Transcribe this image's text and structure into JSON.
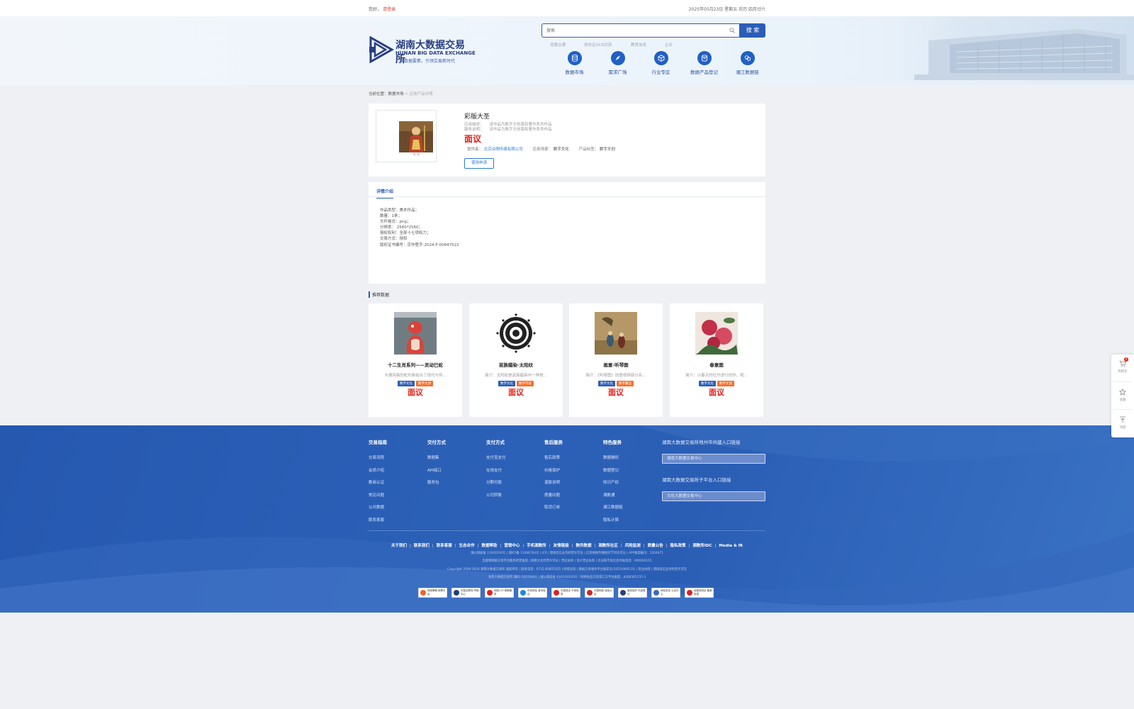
{
  "topbar": {
    "greeting": "您好，",
    "login": "请登录",
    "date": "2025年05月23日 星期五 农历 四月廿六"
  },
  "logo": {
    "cn": "湖南大数据交易所",
    "en": "HUNAN BIG DATA EXCHANGE",
    "slogan": "汇聚数据要素，引领交易新时代"
  },
  "search": {
    "placeholder": "搜索",
    "button": "搜 索",
    "hot": [
      "道路交通",
      "身份证OCR识别",
      "教育信息",
      "企业"
    ]
  },
  "nav": [
    {
      "label": "数据市场",
      "icon": "database-icon"
    },
    {
      "label": "需求广场",
      "icon": "compass-icon"
    },
    {
      "label": "行业专区",
      "icon": "cube-icon"
    },
    {
      "label": "数据产品登记",
      "icon": "register-icon"
    },
    {
      "label": "湘江数据链",
      "icon": "link-icon"
    }
  ],
  "breadcrumb": {
    "prefix": "当前位置：",
    "market": "数据市场",
    "sep": " > ",
    "current": "应用产品详情"
  },
  "product": {
    "thumb_caption": "彩 版",
    "title": "彩版大圣",
    "usage_label": "应用描述：",
    "usage_value": "该作品为数字文创版权著作系列作品",
    "service_label": "服务说明：",
    "service_value": "该作品为数字文创版权著作系列作品",
    "price": "面议",
    "provider_label": "提供者：",
    "provider_value": "北京泊侗传媒有限公司",
    "scene_label": "应用场景：",
    "scene_value": "数字文化",
    "tag_label": "产品标签：",
    "tag_value": "数字文创",
    "apply_button": "使用申请"
  },
  "detail": {
    "tab": "详情介绍",
    "lines": [
      "作品类型：美术作品；",
      "数量：1条；",
      "文件格式：png；",
      "分辨率：  2560*2560；",
      "授权权利：全部十七项权力；",
      "交易方式：授权",
      "版权证书编号：京作登字-2024-F-00847522"
    ]
  },
  "recommend": {
    "title": "推荐数据",
    "cards": [
      {
        "name": "十二生肖系列——灵动巳蛇",
        "desc": "卡通风格的蛇形象结合了现代与传...",
        "tag1": "数字文化",
        "tag2": "数字文创",
        "price": "面议"
      },
      {
        "name": "苗族蜡染-太阳纹",
        "desc": "简介：太阳纹是苗族蜡染中一种常...",
        "tag1": "数字文化",
        "tag2": "数字内容",
        "price": "面议"
      },
      {
        "name": "画意-听琴图",
        "desc": "简介：《听琴图》创意视频部分名...",
        "tag1": "数字文化",
        "tag2": "数字藏品",
        "price": "面议"
      },
      {
        "name": "春意图",
        "desc": "简介：以春天的牡丹进行创作，视...",
        "tag1": "数字文化",
        "tag2": "数字文创",
        "price": "面议"
      }
    ]
  },
  "footer": {
    "columns": [
      {
        "title": "交易指南",
        "items": [
          "交易流程",
          "会员介绍",
          "数商认证",
          "常见问题",
          "公共数据",
          "联系客服"
        ]
      },
      {
        "title": "交付方式",
        "items": [
          "数据集",
          "API接口",
          "服务包"
        ]
      },
      {
        "title": "支付方式",
        "items": [
          "支付宝支付",
          "在线支付",
          "分期付款",
          "公司转账"
        ]
      },
      {
        "title": "售后服务",
        "items": [
          "售后政策",
          "价格保护",
          "退款说明",
          "质量问题",
          "取消订单"
        ]
      },
      {
        "title": "特色服务",
        "items": [
          "数据确权",
          "数据登记",
          "知识产权",
          "湘数通",
          "湘江数据链",
          "隐私计算"
        ]
      }
    ],
    "portal1_title": "湖南大数据交易所地州市共建入口链接",
    "portal1_select": "湖南大数据交易中心",
    "portal2_title": "湖南大数据交易所子平台入口链接",
    "portal2_select": "文化大数据交易中心",
    "links": [
      "关于我们",
      "联系我们",
      "联系客服",
      "生态合作",
      "数据帮助",
      "营销中心",
      "手机湘数所",
      "友情链接",
      "数所数据",
      "湘数所社区",
      "风险监测",
      "质量公告",
      "隐私政策",
      "湘数所IDC",
      "Media & IR"
    ],
    "rows": [
      "湘公网安备 11000200号  |  湘ICP备 11046784号  |  ICP  |  增值电信业务经营许可证  |  信息网络传播视听节目许可证  |  APP备案编号：1204071",
      "出版物网络交易平台服务经营备案  |  网络文化经营许可证  |  营业执照  |  电子营业执照  |  违法和不良信息举报电话：400656155",
      "Copyright 2000-2024 湖南大数据交易所 版权所有  |  联系电话：0731-85855355  |  经营证照  |  数据交易服务平台备案号(2025)00013号  |  营业执照  |  增值电信业务经营许可证",
      "湖南大数据交易所 湘B2-20250001  |  湘公网安备 43010302001  |  网络食品交易第三方平台备案：4008365155-3"
    ],
    "badges": [
      "网络警察 报警平台",
      "中国互联网 举报中心",
      "网络110 报警服务",
      "可信网站 身份验证",
      "中国违法 不良信息",
      "中国网络 诚信认证",
      "版权保护 作品登记",
      "网站安全 认证中心",
      "经营性网站 备案信息"
    ]
  },
  "floatbar": {
    "cart_count": "0",
    "cart": "购物车",
    "fav": "收藏",
    "top": "顶部"
  }
}
